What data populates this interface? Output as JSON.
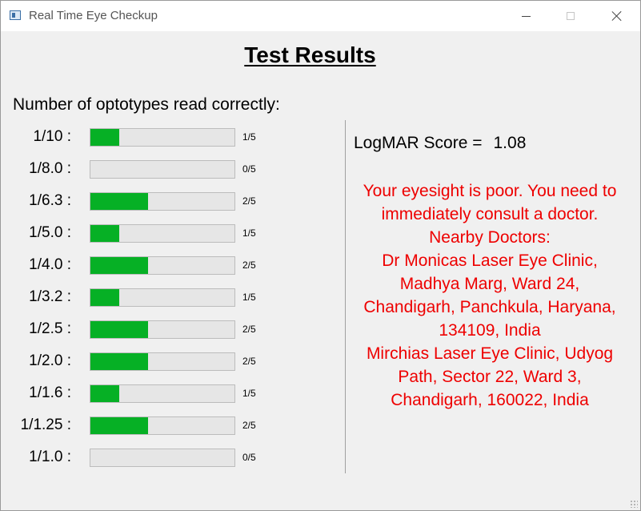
{
  "window": {
    "title": "Real Time Eye Checkup"
  },
  "heading": "Test Results",
  "optotypes": {
    "heading": "Number of optotypes read correctly:",
    "total": 5,
    "rows": [
      {
        "label": "1/10  :",
        "correct": 1,
        "text": "1/5"
      },
      {
        "label": "1/8.0 :",
        "correct": 0,
        "text": "0/5"
      },
      {
        "label": "1/6.3 :",
        "correct": 2,
        "text": "2/5"
      },
      {
        "label": "1/5.0 :",
        "correct": 1,
        "text": "1/5"
      },
      {
        "label": "1/4.0 :",
        "correct": 2,
        "text": "2/5"
      },
      {
        "label": "1/3.2 :",
        "correct": 1,
        "text": "1/5"
      },
      {
        "label": "1/2.5 :",
        "correct": 2,
        "text": "2/5"
      },
      {
        "label": "1/2.0 :",
        "correct": 2,
        "text": "2/5"
      },
      {
        "label": "1/1.6 :",
        "correct": 1,
        "text": "1/5"
      },
      {
        "label": "1/1.25 :",
        "correct": 2,
        "text": "2/5"
      },
      {
        "label": "1/1.0 :",
        "correct": 0,
        "text": "0/5"
      }
    ]
  },
  "score": {
    "label": "LogMAR Score =",
    "value": "1.08"
  },
  "advice": {
    "message": "Your eyesight is poor. You need to immediately consult a doctor.",
    "doctors_heading": "Nearby Doctors:",
    "doctors": [
      "Dr Monicas Laser Eye Clinic, Madhya Marg, Ward 24, Chandigarh, Panchkula, Haryana, 134109, India",
      "Mirchias Laser Eye Clinic, Udyog Path, Sector 22, Ward 3, Chandigarh, 160022, India"
    ]
  },
  "colors": {
    "progress_fill": "#06b025",
    "progress_track": "#e6e6e6",
    "advice_text": "#ee0000",
    "window_bg": "#f0f0f0"
  },
  "icons": {
    "app": "window-app-icon",
    "minimize": "minimize-icon",
    "maximize": "maximize-icon",
    "close": "close-icon",
    "resize": "resize-grip-icon"
  }
}
